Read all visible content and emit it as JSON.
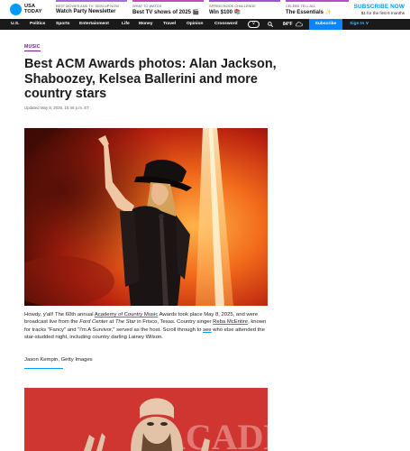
{
  "brand": {
    "logo_text_line1": "USA",
    "logo_text_line2": "TODAY",
    "color": "#009bff"
  },
  "promos": [
    {
      "kicker": "BEST MOVIES AND TV: SIGN UP NOW",
      "headline": "Watch Party Newsletter",
      "bar_color": "#a56be0"
    },
    {
      "kicker": "WHAT TO WATCH",
      "headline": "Best TV shows of 2025 🎬",
      "bar_color": "#c84ab5"
    },
    {
      "kicker": "SPRING BOOK CHALLENGE",
      "headline": "Win $100 📚",
      "bar_color": "#9a54d6"
    },
    {
      "kicker": "CELEBS TELL ALL",
      "headline": "The Essentials ✨",
      "bar_color": "#ae4fc8"
    }
  ],
  "subscribe_cta": {
    "title": "SUBSCRIBE NOW",
    "subtitle": "$1 for the first 6 months"
  },
  "nav": {
    "items": [
      "U.S.",
      "Politics",
      "Sports",
      "Entertainment",
      "Life",
      "Money",
      "Travel",
      "Opinion",
      "Crossword"
    ],
    "more_label": "∨",
    "temperature": "84°F",
    "subscribe_label": "Subscribe",
    "signin_label": "Sign In ∨"
  },
  "article": {
    "section_tag": "MUSIC",
    "headline": "Best ACM Awards photos: Alan Jackson, Shaboozey, Kelsea Ballerini and more country stars",
    "dateline": "Updated May 8, 2025, 10:46 p.m. ET",
    "caption": {
      "part1": "Howdy, y'all! The 60th annual ",
      "link1": "Academy of Country Music",
      "part2": " Awards took place May 8, 2025, and were broadcast live from the ",
      "italic1": "Ford Center at The Star",
      "part3": " in Frisco, Texas. Country singer ",
      "link2": "Reba McEntire",
      "part4": ", known for tracks \"Fancy\" and \"I'm A Survivor,\" served as the host. Scroll through to ",
      "link3": "see",
      "part5": " who else attended the star-studded night, including country darling Lainey Wilson."
    },
    "credit": "Jason Kempin, Getty Images",
    "photo2_sign_text": "ACADEMY"
  }
}
